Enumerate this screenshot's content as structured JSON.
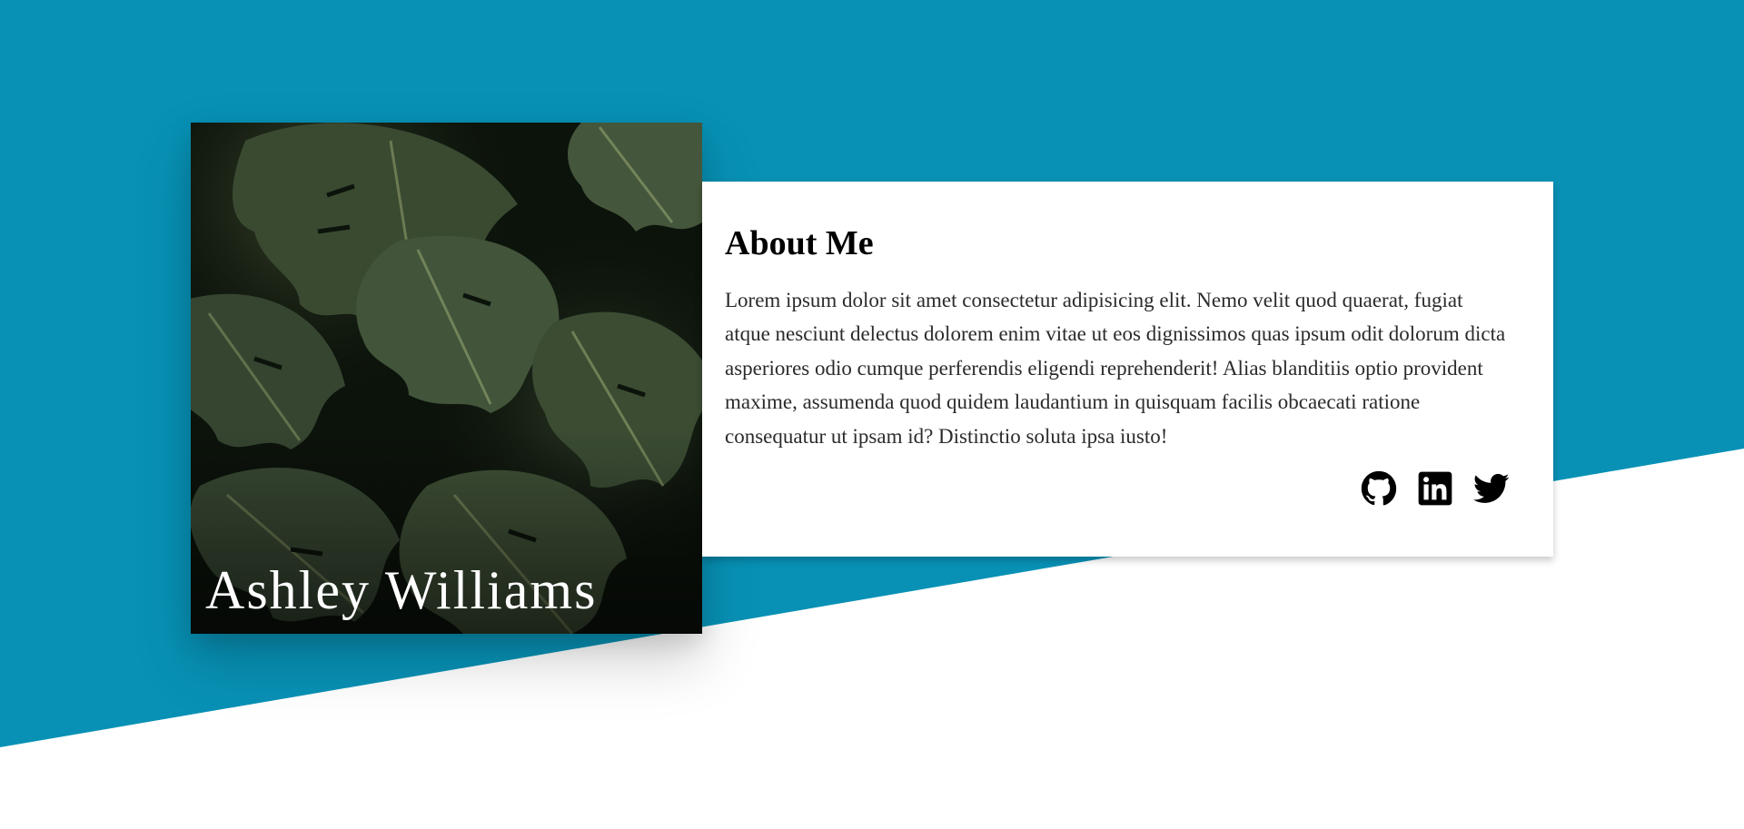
{
  "profile": {
    "name": "Ashley Williams",
    "photo_icon": "monstera-leaves-photo"
  },
  "about": {
    "heading": "About Me",
    "body": "Lorem ipsum dolor sit amet consectetur adipisicing elit. Nemo velit quod quaerat, fugiat atque nesciunt delectus dolorem enim vitae ut eos dignissimos quas ipsum odit dolorum dicta asperiores odio cumque perferendis eligendi reprehenderit! Alias blanditiis optio provident maxime, assumenda quod quidem laudantium in quisquam facilis obcaecati ratione consequatur ut ipsam id? Distinctio soluta ipsa iusto!"
  },
  "socials": [
    {
      "icon": "github-icon"
    },
    {
      "icon": "linkedin-icon"
    },
    {
      "icon": "twitter-icon"
    }
  ],
  "colors": {
    "background_band": "#0891b5",
    "card": "#ffffff",
    "name_text": "#ffffff",
    "icon": "#000000"
  }
}
